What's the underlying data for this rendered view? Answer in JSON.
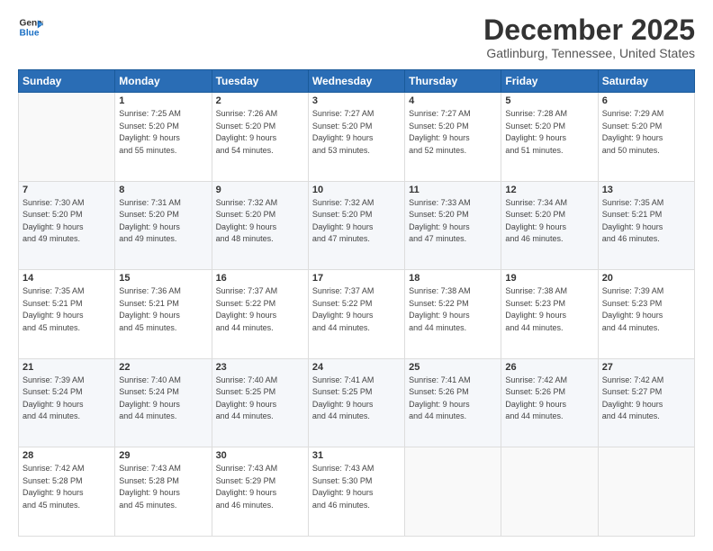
{
  "logo": {
    "line1": "General",
    "line2": "Blue"
  },
  "title": "December 2025",
  "subtitle": "Gatlinburg, Tennessee, United States",
  "weekdays": [
    "Sunday",
    "Monday",
    "Tuesday",
    "Wednesday",
    "Thursday",
    "Friday",
    "Saturday"
  ],
  "weeks": [
    [
      {
        "day": "",
        "info": ""
      },
      {
        "day": "1",
        "info": "Sunrise: 7:25 AM\nSunset: 5:20 PM\nDaylight: 9 hours\nand 55 minutes."
      },
      {
        "day": "2",
        "info": "Sunrise: 7:26 AM\nSunset: 5:20 PM\nDaylight: 9 hours\nand 54 minutes."
      },
      {
        "day": "3",
        "info": "Sunrise: 7:27 AM\nSunset: 5:20 PM\nDaylight: 9 hours\nand 53 minutes."
      },
      {
        "day": "4",
        "info": "Sunrise: 7:27 AM\nSunset: 5:20 PM\nDaylight: 9 hours\nand 52 minutes."
      },
      {
        "day": "5",
        "info": "Sunrise: 7:28 AM\nSunset: 5:20 PM\nDaylight: 9 hours\nand 51 minutes."
      },
      {
        "day": "6",
        "info": "Sunrise: 7:29 AM\nSunset: 5:20 PM\nDaylight: 9 hours\nand 50 minutes."
      }
    ],
    [
      {
        "day": "7",
        "info": "Sunrise: 7:30 AM\nSunset: 5:20 PM\nDaylight: 9 hours\nand 49 minutes."
      },
      {
        "day": "8",
        "info": "Sunrise: 7:31 AM\nSunset: 5:20 PM\nDaylight: 9 hours\nand 49 minutes."
      },
      {
        "day": "9",
        "info": "Sunrise: 7:32 AM\nSunset: 5:20 PM\nDaylight: 9 hours\nand 48 minutes."
      },
      {
        "day": "10",
        "info": "Sunrise: 7:32 AM\nSunset: 5:20 PM\nDaylight: 9 hours\nand 47 minutes."
      },
      {
        "day": "11",
        "info": "Sunrise: 7:33 AM\nSunset: 5:20 PM\nDaylight: 9 hours\nand 47 minutes."
      },
      {
        "day": "12",
        "info": "Sunrise: 7:34 AM\nSunset: 5:20 PM\nDaylight: 9 hours\nand 46 minutes."
      },
      {
        "day": "13",
        "info": "Sunrise: 7:35 AM\nSunset: 5:21 PM\nDaylight: 9 hours\nand 46 minutes."
      }
    ],
    [
      {
        "day": "14",
        "info": "Sunrise: 7:35 AM\nSunset: 5:21 PM\nDaylight: 9 hours\nand 45 minutes."
      },
      {
        "day": "15",
        "info": "Sunrise: 7:36 AM\nSunset: 5:21 PM\nDaylight: 9 hours\nand 45 minutes."
      },
      {
        "day": "16",
        "info": "Sunrise: 7:37 AM\nSunset: 5:22 PM\nDaylight: 9 hours\nand 44 minutes."
      },
      {
        "day": "17",
        "info": "Sunrise: 7:37 AM\nSunset: 5:22 PM\nDaylight: 9 hours\nand 44 minutes."
      },
      {
        "day": "18",
        "info": "Sunrise: 7:38 AM\nSunset: 5:22 PM\nDaylight: 9 hours\nand 44 minutes."
      },
      {
        "day": "19",
        "info": "Sunrise: 7:38 AM\nSunset: 5:23 PM\nDaylight: 9 hours\nand 44 minutes."
      },
      {
        "day": "20",
        "info": "Sunrise: 7:39 AM\nSunset: 5:23 PM\nDaylight: 9 hours\nand 44 minutes."
      }
    ],
    [
      {
        "day": "21",
        "info": "Sunrise: 7:39 AM\nSunset: 5:24 PM\nDaylight: 9 hours\nand 44 minutes."
      },
      {
        "day": "22",
        "info": "Sunrise: 7:40 AM\nSunset: 5:24 PM\nDaylight: 9 hours\nand 44 minutes."
      },
      {
        "day": "23",
        "info": "Sunrise: 7:40 AM\nSunset: 5:25 PM\nDaylight: 9 hours\nand 44 minutes."
      },
      {
        "day": "24",
        "info": "Sunrise: 7:41 AM\nSunset: 5:25 PM\nDaylight: 9 hours\nand 44 minutes."
      },
      {
        "day": "25",
        "info": "Sunrise: 7:41 AM\nSunset: 5:26 PM\nDaylight: 9 hours\nand 44 minutes."
      },
      {
        "day": "26",
        "info": "Sunrise: 7:42 AM\nSunset: 5:26 PM\nDaylight: 9 hours\nand 44 minutes."
      },
      {
        "day": "27",
        "info": "Sunrise: 7:42 AM\nSunset: 5:27 PM\nDaylight: 9 hours\nand 44 minutes."
      }
    ],
    [
      {
        "day": "28",
        "info": "Sunrise: 7:42 AM\nSunset: 5:28 PM\nDaylight: 9 hours\nand 45 minutes."
      },
      {
        "day": "29",
        "info": "Sunrise: 7:43 AM\nSunset: 5:28 PM\nDaylight: 9 hours\nand 45 minutes."
      },
      {
        "day": "30",
        "info": "Sunrise: 7:43 AM\nSunset: 5:29 PM\nDaylight: 9 hours\nand 46 minutes."
      },
      {
        "day": "31",
        "info": "Sunrise: 7:43 AM\nSunset: 5:30 PM\nDaylight: 9 hours\nand 46 minutes."
      },
      {
        "day": "",
        "info": ""
      },
      {
        "day": "",
        "info": ""
      },
      {
        "day": "",
        "info": ""
      }
    ]
  ]
}
